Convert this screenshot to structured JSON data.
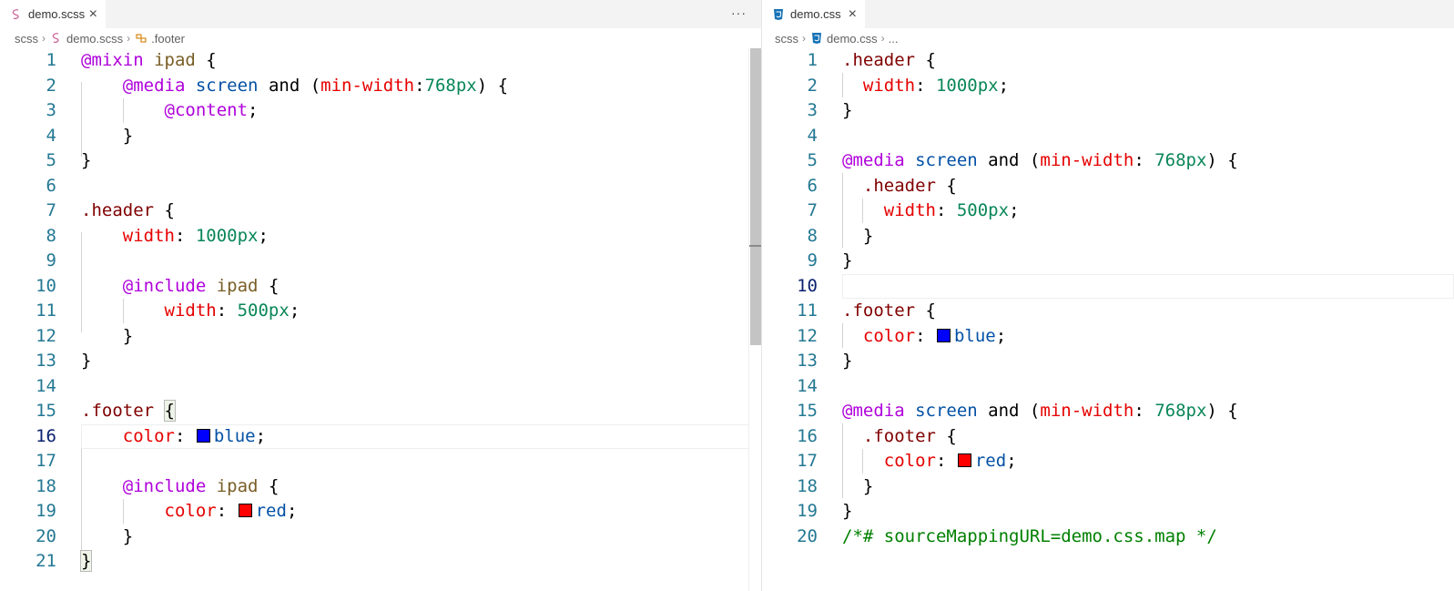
{
  "left": {
    "tab": {
      "label": "demo.scss",
      "close": "×"
    },
    "more_actions": "···",
    "breadcrumb": [
      "scss",
      "demo.scss",
      ".footer"
    ],
    "lines": [
      {
        "n": "1",
        "tokens": [
          [
            "kw",
            "@mixin"
          ],
          [
            "punc",
            " "
          ],
          [
            "fn",
            "ipad"
          ],
          [
            "punc",
            " {"
          ]
        ]
      },
      {
        "n": "2",
        "tokens": [
          [
            "punc",
            "    "
          ],
          [
            "kw",
            "@media"
          ],
          [
            "punc",
            " "
          ],
          [
            "val",
            "screen"
          ],
          [
            "punc",
            " and ("
          ],
          [
            "prop",
            "min-width"
          ],
          [
            "punc",
            ":"
          ],
          [
            "num",
            "768px"
          ],
          [
            "punc",
            ") {"
          ]
        ]
      },
      {
        "n": "3",
        "tokens": [
          [
            "punc",
            "        "
          ],
          [
            "kw",
            "@content"
          ],
          [
            "punc",
            ";"
          ]
        ]
      },
      {
        "n": "4",
        "tokens": [
          [
            "punc",
            "    }"
          ]
        ]
      },
      {
        "n": "5",
        "tokens": [
          [
            "punc",
            "}"
          ]
        ]
      },
      {
        "n": "6",
        "tokens": []
      },
      {
        "n": "7",
        "tokens": [
          [
            "sel",
            ".header"
          ],
          [
            "punc",
            " {"
          ]
        ]
      },
      {
        "n": "8",
        "tokens": [
          [
            "punc",
            "    "
          ],
          [
            "prop",
            "width"
          ],
          [
            "punc",
            ": "
          ],
          [
            "num",
            "1000px"
          ],
          [
            "punc",
            ";"
          ]
        ]
      },
      {
        "n": "9",
        "tokens": []
      },
      {
        "n": "10",
        "tokens": [
          [
            "punc",
            "    "
          ],
          [
            "kw",
            "@include"
          ],
          [
            "punc",
            " "
          ],
          [
            "fn",
            "ipad"
          ],
          [
            "punc",
            " {"
          ]
        ]
      },
      {
        "n": "11",
        "tokens": [
          [
            "punc",
            "        "
          ],
          [
            "prop",
            "width"
          ],
          [
            "punc",
            ": "
          ],
          [
            "num",
            "500px"
          ],
          [
            "punc",
            ";"
          ]
        ]
      },
      {
        "n": "12",
        "tokens": [
          [
            "punc",
            "    }"
          ]
        ]
      },
      {
        "n": "13",
        "tokens": [
          [
            "punc",
            "}"
          ]
        ]
      },
      {
        "n": "14",
        "tokens": []
      },
      {
        "n": "15",
        "tokens": [
          [
            "sel",
            ".footer"
          ],
          [
            "punc",
            " "
          ],
          [
            "bracket",
            "{"
          ]
        ]
      },
      {
        "n": "16",
        "tokens": [
          [
            "punc",
            "    "
          ],
          [
            "prop",
            "color"
          ],
          [
            "punc",
            ": "
          ],
          [
            "swatch",
            "#0000ff"
          ],
          [
            "val",
            "blue"
          ],
          [
            "punc",
            ";"
          ]
        ]
      },
      {
        "n": "17",
        "tokens": []
      },
      {
        "n": "18",
        "tokens": [
          [
            "punc",
            "    "
          ],
          [
            "kw",
            "@include"
          ],
          [
            "punc",
            " "
          ],
          [
            "fn",
            "ipad"
          ],
          [
            "punc",
            " {"
          ]
        ]
      },
      {
        "n": "19",
        "tokens": [
          [
            "punc",
            "        "
          ],
          [
            "prop",
            "color"
          ],
          [
            "punc",
            ": "
          ],
          [
            "swatch",
            "#ff0000"
          ],
          [
            "val",
            "red"
          ],
          [
            "punc",
            ";"
          ]
        ]
      },
      {
        "n": "20",
        "tokens": [
          [
            "punc",
            "    }"
          ]
        ]
      },
      {
        "n": "21",
        "tokens": [
          [
            "bracket",
            "}"
          ]
        ]
      }
    ]
  },
  "right": {
    "tab": {
      "label": "demo.css",
      "close": "×"
    },
    "breadcrumb": [
      "scss",
      "demo.css",
      "..."
    ],
    "lines": [
      {
        "n": "1",
        "tokens": [
          [
            "sel",
            ".header"
          ],
          [
            "punc",
            " {"
          ]
        ]
      },
      {
        "n": "2",
        "tokens": [
          [
            "punc",
            "  "
          ],
          [
            "prop",
            "width"
          ],
          [
            "punc",
            ": "
          ],
          [
            "num",
            "1000px"
          ],
          [
            "punc",
            ";"
          ]
        ]
      },
      {
        "n": "3",
        "tokens": [
          [
            "punc",
            "}"
          ]
        ]
      },
      {
        "n": "4",
        "tokens": []
      },
      {
        "n": "5",
        "tokens": [
          [
            "kw",
            "@media"
          ],
          [
            "punc",
            " "
          ],
          [
            "val",
            "screen"
          ],
          [
            "punc",
            " and ("
          ],
          [
            "prop",
            "min-width"
          ],
          [
            "punc",
            ": "
          ],
          [
            "num",
            "768px"
          ],
          [
            "punc",
            ") {"
          ]
        ]
      },
      {
        "n": "6",
        "tokens": [
          [
            "punc",
            "  "
          ],
          [
            "sel",
            ".header"
          ],
          [
            "punc",
            " {"
          ]
        ]
      },
      {
        "n": "7",
        "tokens": [
          [
            "punc",
            "    "
          ],
          [
            "prop",
            "width"
          ],
          [
            "punc",
            ": "
          ],
          [
            "num",
            "500px"
          ],
          [
            "punc",
            ";"
          ]
        ]
      },
      {
        "n": "8",
        "tokens": [
          [
            "punc",
            "  }"
          ]
        ]
      },
      {
        "n": "9",
        "tokens": [
          [
            "punc",
            "}"
          ]
        ]
      },
      {
        "n": "10",
        "tokens": []
      },
      {
        "n": "11",
        "tokens": [
          [
            "sel",
            ".footer"
          ],
          [
            "punc",
            " {"
          ]
        ]
      },
      {
        "n": "12",
        "tokens": [
          [
            "punc",
            "  "
          ],
          [
            "prop",
            "color"
          ],
          [
            "punc",
            ": "
          ],
          [
            "swatch",
            "#0000ff"
          ],
          [
            "val",
            "blue"
          ],
          [
            "punc",
            ";"
          ]
        ]
      },
      {
        "n": "13",
        "tokens": [
          [
            "punc",
            "}"
          ]
        ]
      },
      {
        "n": "14",
        "tokens": []
      },
      {
        "n": "15",
        "tokens": [
          [
            "kw",
            "@media"
          ],
          [
            "punc",
            " "
          ],
          [
            "val",
            "screen"
          ],
          [
            "punc",
            " and ("
          ],
          [
            "prop",
            "min-width"
          ],
          [
            "punc",
            ": "
          ],
          [
            "num",
            "768px"
          ],
          [
            "punc",
            ") {"
          ]
        ]
      },
      {
        "n": "16",
        "tokens": [
          [
            "punc",
            "  "
          ],
          [
            "sel",
            ".footer"
          ],
          [
            "punc",
            " {"
          ]
        ]
      },
      {
        "n": "17",
        "tokens": [
          [
            "punc",
            "    "
          ],
          [
            "prop",
            "color"
          ],
          [
            "punc",
            ": "
          ],
          [
            "swatch",
            "#ff0000"
          ],
          [
            "val",
            "red"
          ],
          [
            "punc",
            ";"
          ]
        ]
      },
      {
        "n": "18",
        "tokens": [
          [
            "punc",
            "  }"
          ]
        ]
      },
      {
        "n": "19",
        "tokens": [
          [
            "punc",
            "}"
          ]
        ]
      },
      {
        "n": "20",
        "tokens": [
          [
            "cmt",
            "/*# sourceMappingURL=demo.css.map */"
          ]
        ]
      }
    ]
  },
  "cursor_line": {
    "left": "16",
    "right": "10"
  },
  "colors": {
    "line_number": "#237893",
    "active_line_number": "#0b216f",
    "keyword": "#af00db",
    "property": "#e50000",
    "number": "#098658",
    "value": "#0451a5",
    "selector": "#800000",
    "function": "#795e26",
    "comment": "#008000"
  },
  "icons": {
    "scss_file": "sass-icon",
    "css_file": "css3-icon",
    "selector_symbol": "class-symbol-icon"
  }
}
